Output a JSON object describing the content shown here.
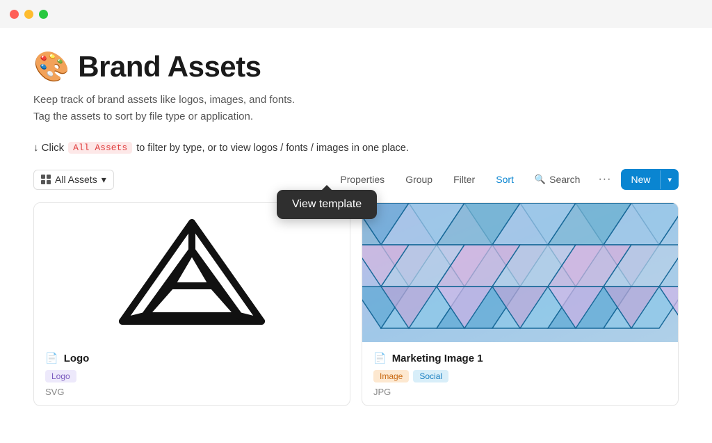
{
  "titleBar": {
    "trafficLights": [
      "red",
      "yellow",
      "green"
    ]
  },
  "page": {
    "emoji": "🎨",
    "title": "Brand Assets",
    "description_line1": "Keep track of brand assets like logos, images, and fonts.",
    "description_line2": "Tag the assets to sort by file type or application.",
    "hint_prefix": "↓ Click",
    "hint_tag": "All Assets",
    "hint_suffix": "to filter by type, or to view logos / fonts / images in one place."
  },
  "toolbar": {
    "view_icon_label": "grid-icon",
    "view_label": "All Assets",
    "view_chevron": "▾",
    "properties_label": "Properties",
    "group_label": "Group",
    "filter_label": "Filter",
    "sort_label": "Sort",
    "search_label": "Search",
    "more_label": "···",
    "new_label": "New",
    "new_arrow": "▾"
  },
  "tooltip": {
    "label": "View template"
  },
  "cards": [
    {
      "id": "logo",
      "title": "Logo",
      "tags": [
        "Logo"
      ],
      "tag_styles": [
        "logo"
      ],
      "filetype": "SVG",
      "image_type": "logo"
    },
    {
      "id": "marketing-image-1",
      "title": "Marketing Image 1",
      "tags": [
        "Image",
        "Social"
      ],
      "tag_styles": [
        "image",
        "social"
      ],
      "filetype": "JPG",
      "image_type": "marketing"
    }
  ]
}
